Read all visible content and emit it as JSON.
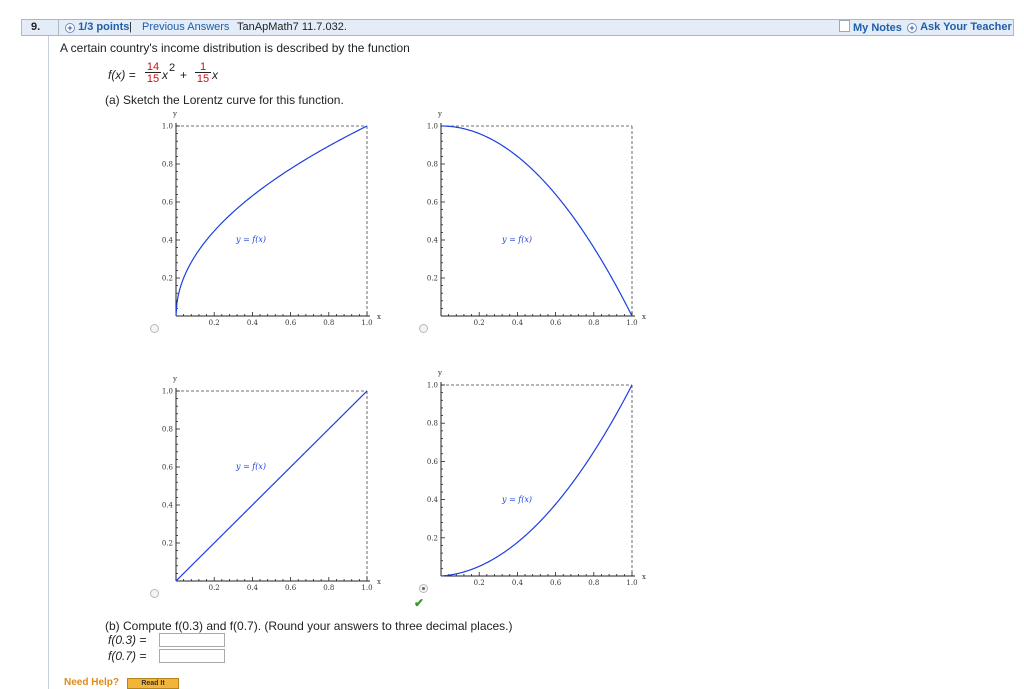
{
  "header": {
    "question_number": "9.",
    "points": "1/3 points",
    "separator": "|",
    "previous_answers": "Previous Answers",
    "source": "TanApMath7 11.7.032.",
    "my_notes": "My Notes",
    "ask_teacher": "Ask Your Teacher"
  },
  "problem": {
    "intro": "A certain country's income distribution is described by the function",
    "func_lhs": "f(x) =",
    "frac1_num": "14",
    "frac1_den": "15",
    "term1": "x",
    "exp": "2",
    "plus": "+",
    "frac2_num": "1",
    "frac2_den": "15",
    "term2": "x"
  },
  "part_a": {
    "prompt": "(a) Sketch the Lorentz curve for this function."
  },
  "graph_common": {
    "y_axis_label": "y",
    "x_axis_label": "x",
    "x_ticks": [
      "0.2",
      "0.4",
      "0.6",
      "0.8",
      "1.0"
    ],
    "y_ticks": [
      "0.2",
      "0.4",
      "0.6",
      "0.8",
      "1.0"
    ],
    "curve_label": "y = f(x)",
    "curve_color": "#1a3fe0"
  },
  "graphs": [
    {
      "id": "A",
      "curve": "sqrt",
      "selected": false
    },
    {
      "id": "B",
      "curve": "one_minus_square",
      "selected": false
    },
    {
      "id": "C",
      "curve": "linear",
      "selected": false
    },
    {
      "id": "D",
      "curve": "given_function",
      "selected": true,
      "correct_mark": "✔"
    }
  ],
  "part_b": {
    "prompt": "(b) Compute f(0.3) and f(0.7). (Round your answers to three decimal places.)",
    "f03_label": "f(0.3) =",
    "f07_label": "f(0.7) =",
    "f03_value": "",
    "f07_value": ""
  },
  "help": {
    "need_help": "Need Help?",
    "read_it": "Read It"
  }
}
